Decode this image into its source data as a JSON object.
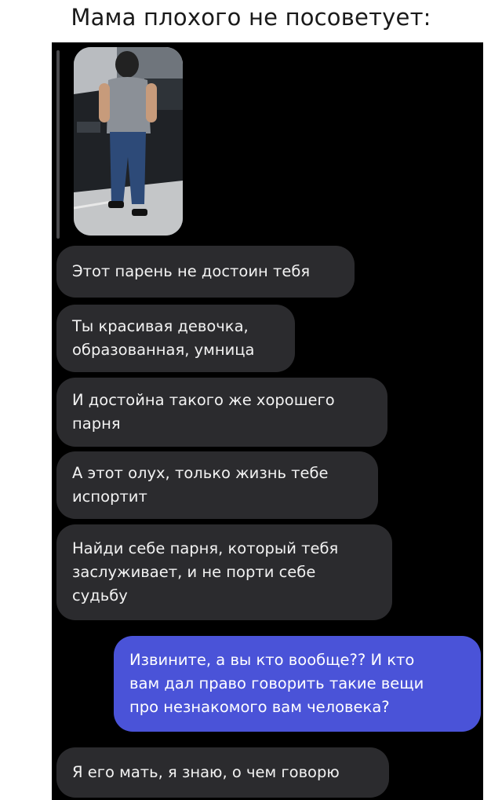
{
  "caption": "Мама плохого не посоветует:",
  "chat": {
    "attachment": {
      "type": "photo",
      "icon": "photo-of-man-by-car"
    },
    "messages": [
      {
        "id": "m1",
        "direction": "incoming",
        "text": "Этот парень не достоин тебя"
      },
      {
        "id": "m2",
        "direction": "incoming",
        "text": "Ты красивая девочка,\nобразованная, умница"
      },
      {
        "id": "m3",
        "direction": "incoming",
        "text": "И достойна такого же хорошего\nпарня"
      },
      {
        "id": "m4",
        "direction": "incoming",
        "text": "А этот олух, только жизнь тебе\nиспортит"
      },
      {
        "id": "m5",
        "direction": "incoming",
        "text": "Найди себе парня, который тебя\nзаслуживает, и не порти себе\nсудьбу"
      },
      {
        "id": "m6",
        "direction": "outgoing",
        "text": "Извините, а вы кто вообще?? И кто\nвам дал право говорить такие вещи\nпро незнакомого вам человека?"
      },
      {
        "id": "m7",
        "direction": "incoming",
        "text": "Я его мать, я знаю, о чем говорю"
      }
    ],
    "colors": {
      "background": "#000000",
      "incoming_bubble": "#2b2b2e",
      "outgoing_bubble": "#4a53d8",
      "text": "#f2f2f2"
    }
  }
}
